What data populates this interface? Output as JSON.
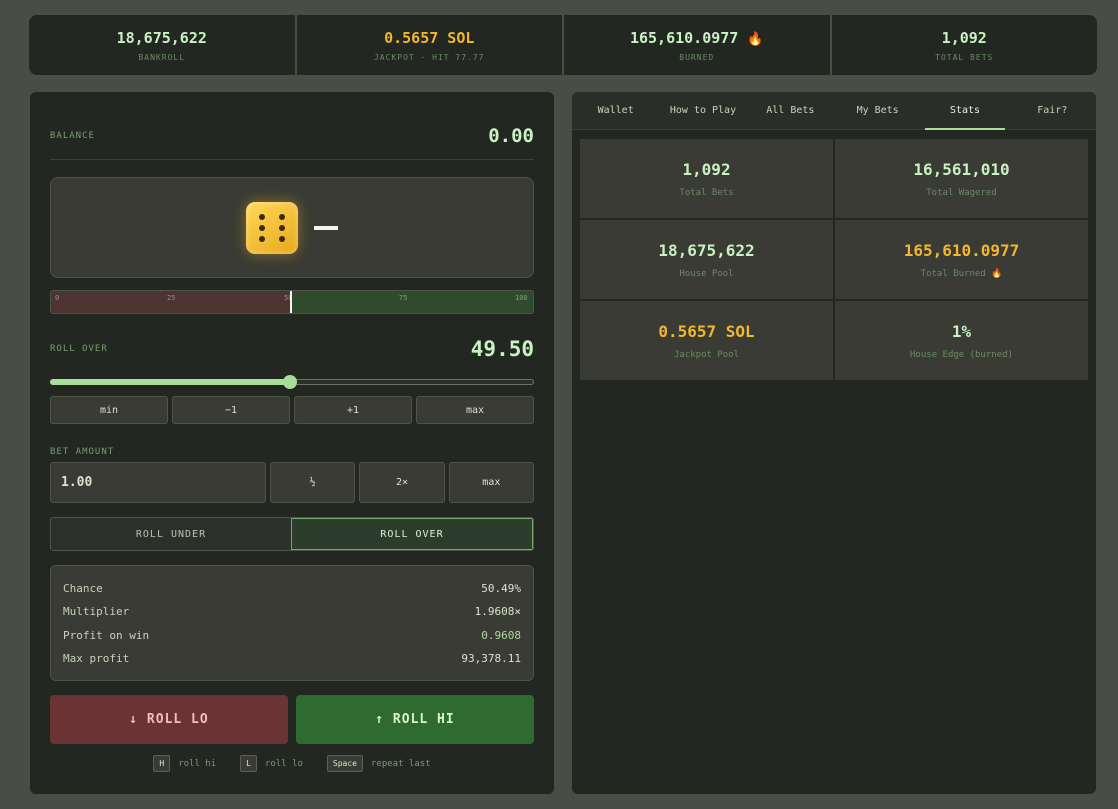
{
  "top_stats": [
    {
      "value": "18,675,622",
      "label": "BANKROLL",
      "gold": false
    },
    {
      "value": "0.5657 SOL",
      "label": "JACKPOT · HIT 77.77",
      "gold": true
    },
    {
      "value": "165,610.0977",
      "label": "BURNED",
      "gold": false
    },
    {
      "value": "1,092",
      "label": "TOTAL BETS",
      "gold": false
    }
  ],
  "flame_icon": "🔥",
  "left": {
    "balance_label": "BALANCE",
    "balance_value": "0.00",
    "dice_result": "—",
    "dice_face": 6,
    "track_ticks": [
      "0",
      "25",
      "50",
      "75",
      "100"
    ],
    "roll_over_label": "ROLL OVER",
    "roll_over_value": "49.50",
    "slider_fraction": 0.495,
    "adjust_buttons": [
      "min",
      "−1",
      "+1",
      "max"
    ],
    "bet_label": "BET AMOUNT",
    "bet_value": "1.00",
    "bet_buttons": [
      "½",
      "2×",
      "max"
    ],
    "toggle": {
      "under": "ROLL UNDER",
      "over": "ROLL OVER",
      "active": "over"
    },
    "info": [
      {
        "k": "Chance",
        "v": "50.49%",
        "green": false
      },
      {
        "k": "Multiplier",
        "v": "1.9608×",
        "green": false
      },
      {
        "k": "Profit on win",
        "v": "0.9608",
        "green": true
      },
      {
        "k": "Max profit",
        "v": "93,378.11",
        "green": false
      }
    ],
    "roll_lo_label": "↓ ROLL LO",
    "roll_hi_label": "↑ ROLL HI",
    "hints": [
      {
        "key": "H",
        "text": "roll hi"
      },
      {
        "key": "L",
        "text": "roll lo"
      },
      {
        "key": "Space",
        "text": "repeat last"
      }
    ]
  },
  "right": {
    "tabs": [
      "Wallet",
      "How to Play",
      "All Bets",
      "My Bets",
      "Stats",
      "Fair?"
    ],
    "active_tab": "Stats",
    "stats": [
      {
        "value": "1,092",
        "label": "Total Bets",
        "gold": false
      },
      {
        "value": "16,561,010",
        "label": "Total Wagered",
        "gold": false
      },
      {
        "value": "18,675,622",
        "label": "House Pool",
        "gold": false
      },
      {
        "value": "165,610.0977",
        "label": "Total Burned 🔥",
        "gold": true
      },
      {
        "value": "0.5657 SOL",
        "label": "Jackpot Pool",
        "gold": true
      },
      {
        "value": "1%",
        "label": "House Edge (burned)",
        "gold": false
      }
    ]
  },
  "colors": {
    "accent": "#a8dd9c",
    "gold": "#f2b630",
    "lo": "#6b3333",
    "hi": "#2f6a2f"
  }
}
